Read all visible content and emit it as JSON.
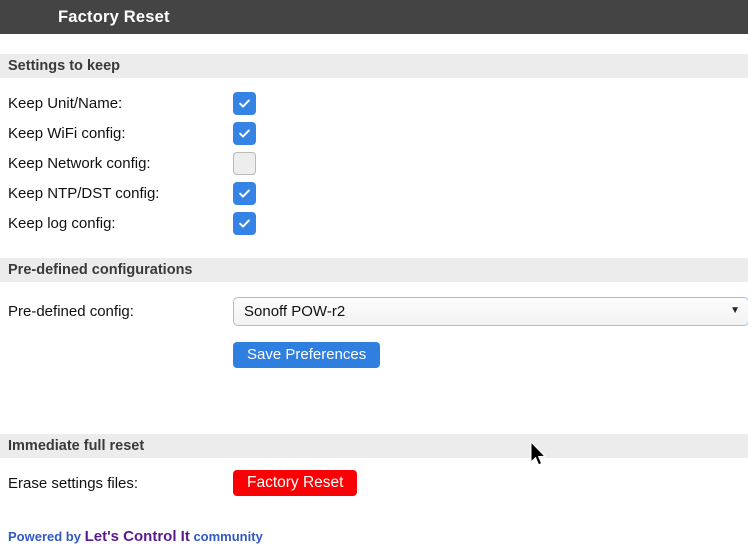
{
  "page": {
    "title": "Factory Reset"
  },
  "sections": {
    "settings_to_keep": {
      "heading": "Settings to keep",
      "items": [
        {
          "label": "Keep Unit/Name:",
          "checked": true
        },
        {
          "label": "Keep WiFi config:",
          "checked": true
        },
        {
          "label": "Keep Network config:",
          "checked": false
        },
        {
          "label": "Keep NTP/DST config:",
          "checked": true
        },
        {
          "label": "Keep log config:",
          "checked": true
        }
      ]
    },
    "predefined_configurations": {
      "heading": "Pre-defined configurations",
      "config_label": "Pre-defined config:",
      "selected_option": "Sonoff POW-r2",
      "options": [
        "Sonoff POW-r2"
      ],
      "save_button": "Save Preferences"
    },
    "immediate_full_reset": {
      "heading": "Immediate full reset",
      "erase_label": "Erase settings files:",
      "reset_button": "Factory Reset"
    }
  },
  "footer": {
    "powered_by": "Powered by",
    "brand": "Let's Control It",
    "community": "community"
  },
  "colors": {
    "titlebar_bg": "#444444",
    "section_bar_bg": "#ececec",
    "checkbox_on": "#3583e4",
    "primary_button": "#2f7fe0",
    "danger_button": "#fa0004",
    "link_blue": "#3159c4",
    "brand_purple": "#5b1b8f"
  },
  "icons": {
    "checkmark": "check-icon",
    "dropdown_arrow": "chevron-down-icon",
    "cursor": "mouse-pointer-icon"
  }
}
